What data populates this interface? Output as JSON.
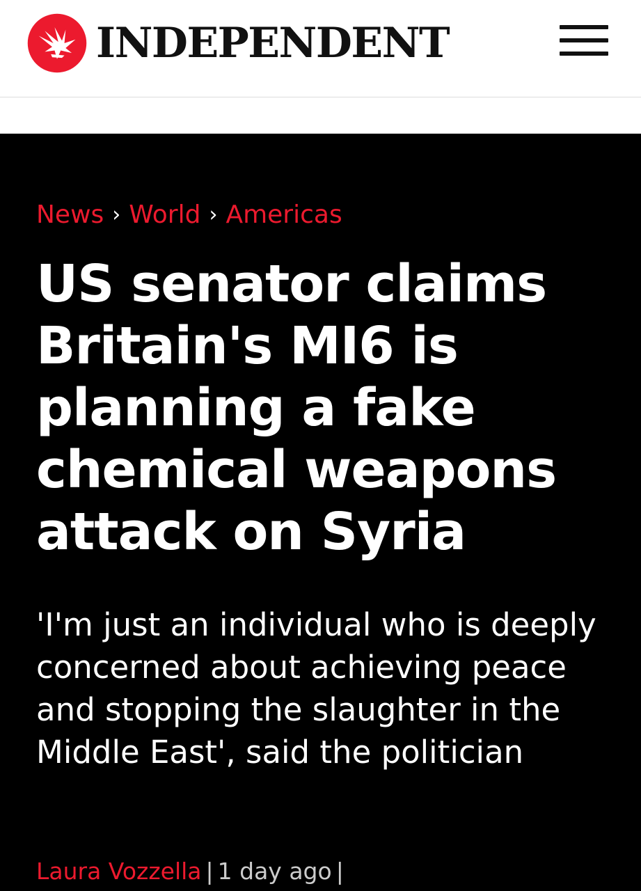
{
  "header": {
    "logo_name": "INDEPENDENT",
    "menu_icon": "hamburger-menu-icon",
    "logo_icon": "eagle-logo-icon"
  },
  "breadcrumb": [
    {
      "label": "News"
    },
    {
      "label": "World"
    },
    {
      "label": "Americas"
    }
  ],
  "breadcrumb_separator": "›",
  "article": {
    "headline": "US senator claims Britain's MI6 is planning a fake chemical weapons attack on Syria",
    "standfirst": "'I'm just an individual who is deeply concerned about achieving peace and stopping the slaughter in the Middle East', said the politician",
    "author": "Laura Vozzella",
    "timestamp": "1 day ago",
    "separator": "|"
  },
  "colors": {
    "accent": "#ec1a2e",
    "background": "#000000",
    "header_bg": "#ffffff",
    "text": "#ffffff"
  }
}
